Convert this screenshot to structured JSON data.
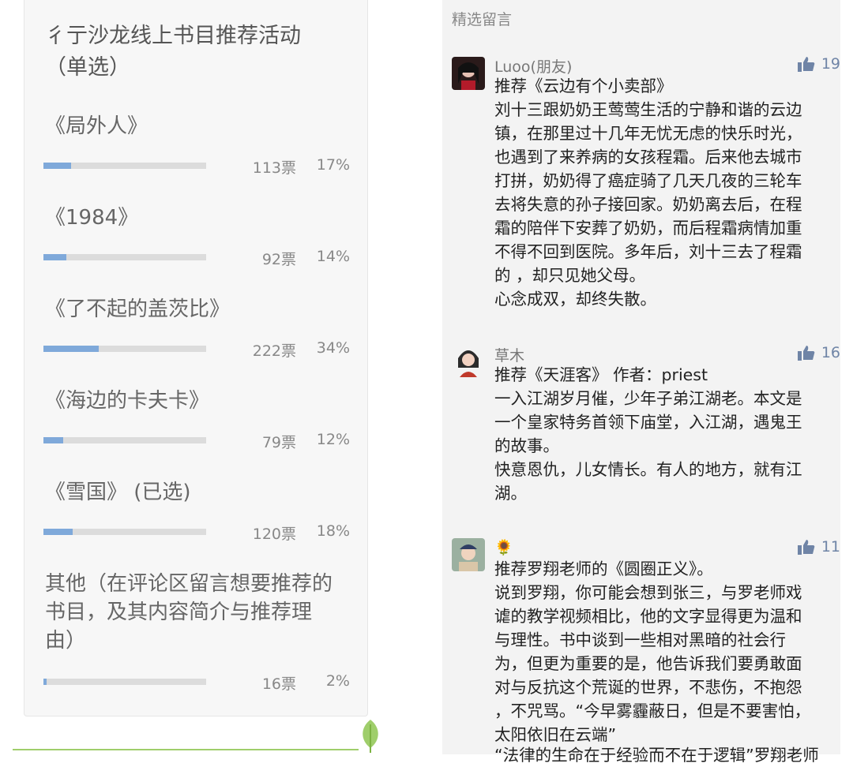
{
  "poll": {
    "title_line1": "彳亍沙龙线上书目推荐活动",
    "title_line2": "（单选）",
    "options": [
      {
        "label": "《局外人》",
        "votes": "113票",
        "percent": "17%",
        "fraction": 0.17
      },
      {
        "label": "《1984》",
        "votes": "92票",
        "percent": "14%",
        "fraction": 0.14
      },
      {
        "label": "《了不起的盖茨比》",
        "votes": "222票",
        "percent": "34%",
        "fraction": 0.34
      },
      {
        "label": "《海边的卡夫卡》",
        "votes": "79票",
        "percent": "12%",
        "fraction": 0.12
      },
      {
        "label": "《雪国》 (已选)",
        "votes": "120票",
        "percent": "18%",
        "fraction": 0.18
      },
      {
        "label_lines": [
          "其他（在评论区留言想要推荐的",
          "书目，及其内容简介与推荐理",
          "由）"
        ],
        "votes": "16票",
        "percent": "2%",
        "fraction": 0.02
      }
    ]
  },
  "comments_section": {
    "header": "精选留言",
    "comments": [
      {
        "name": "Luoo(朋友)",
        "likes": "19",
        "lines": [
          "推荐《云边有个小卖部》",
          "刘十三跟奶奶王莺莺生活的宁静和谐的云边",
          "镇，在那里过十几年无忧无虑的快乐时光，",
          "也遇到了来养病的女孩程霜。后来他去城市",
          "打拼，奶奶得了癌症骑了几天几夜的三轮车",
          "去将失意的孙子接回家。奶奶离去后，在程",
          "霜的陪伴下安葬了奶奶，而后程霜病情加重",
          "不得不回到医院。多年后，刘十三去了程霜",
          "的 ，却只见她父母。",
          "心念成双，却终失散。"
        ]
      },
      {
        "name": "草木",
        "likes": "16",
        "lines": [
          "推荐《天涯客》 作者：priest",
          "一入江湖岁月催，少年子弟江湖老。本文是",
          "一个皇家特务首领下庙堂，入江湖，遇鬼王",
          "的故事。",
          "快意恩仇，儿女情长。有人的地方，就有江",
          "湖。"
        ]
      },
      {
        "name": "🌻",
        "likes": "11",
        "lines": [
          "推荐罗翔老师的《圆圈正义》。",
          "说到罗翔，你可能会想到张三，与罗老师戏",
          "谑的教学视频相比，他的文字显得更为温和",
          "与理性。书中谈到一些相对黑暗的社会行",
          "为，但更为重要的是，他告诉我们要勇敢面",
          "对与反抗这个荒诞的世界，不悲伤，不抱怨",
          "，不咒骂。“今早雾霾蔽日，但是不要害怕，",
          "太阳依旧在云端”",
          "“法律的生命在于经验而不在于逻辑”罗翔老师"
        ]
      }
    ]
  },
  "colors": {
    "bar_fill": "#7fa9da",
    "bar_track": "#dcdcdc",
    "like_blue": "#6f84a6",
    "leaf_green": "#8cc152"
  },
  "icons": {
    "like": "thumbs-up-icon",
    "leaf": "leaf-icon"
  }
}
